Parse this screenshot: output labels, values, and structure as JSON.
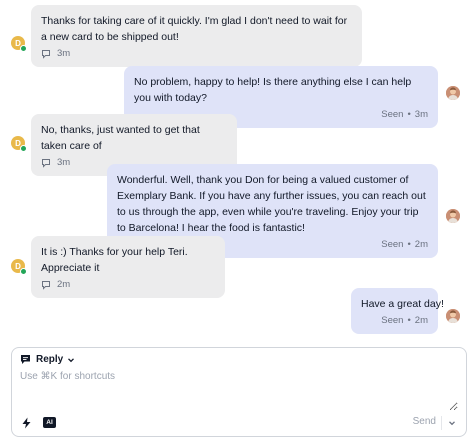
{
  "messages": [
    {
      "from": "customer",
      "avatar_initial": "D",
      "text": "Thanks for taking care of it quickly. I'm glad I don't need to wait for a new card to be shipped out!",
      "time": "3m"
    },
    {
      "from": "agent",
      "text": "No problem, happy to help! Is there anything else I can help you with today?",
      "status": "Seen",
      "time": "3m"
    },
    {
      "from": "customer",
      "avatar_initial": "D",
      "text": "No, thanks, just wanted to get that taken care of",
      "time": "3m"
    },
    {
      "from": "agent",
      "text": "Wonderful. Well, thank you Don for being a valued customer of Exemplary Bank. If you have any further issues, you can reach out to us through the app, even while you're traveling. Enjoy your trip to Barcelona! I hear the food is fantastic!",
      "status": "Seen",
      "time": "2m"
    },
    {
      "from": "customer",
      "avatar_initial": "D",
      "text": "It is :) Thanks for your help Teri. Appreciate it",
      "time": "2m"
    },
    {
      "from": "agent",
      "text": "Have a great day!",
      "status": "Seen",
      "time": "2m"
    }
  ],
  "meta_separator": "•",
  "composer": {
    "mode_label": "Reply",
    "placeholder": "Use ⌘K for shortcuts",
    "ai_label": "AI",
    "send_label": "Send"
  },
  "colors": {
    "customer_bubble": "#ececed",
    "agent_bubble": "#dfe3f8",
    "customer_avatar": "#e9b94a",
    "online_status": "#22a558"
  },
  "icons": {
    "reply": "chat-bubble-icon",
    "message_meta": "chat-icon",
    "quick_actions": "lightning-icon",
    "ai": "ai-icon",
    "send_options": "chevron-down-icon"
  }
}
